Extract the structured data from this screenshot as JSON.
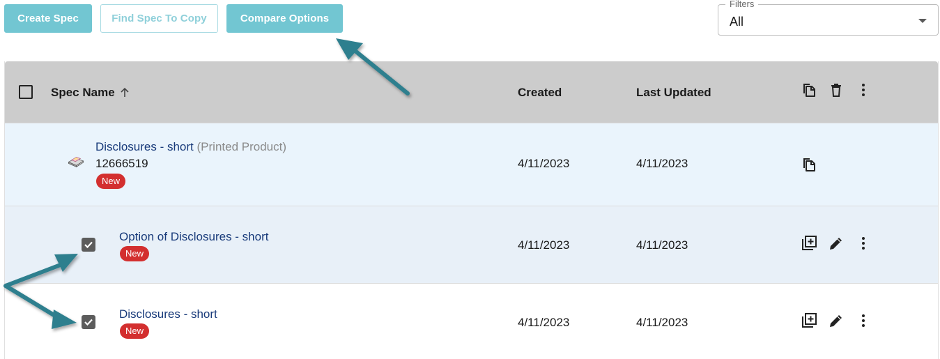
{
  "toolbar": {
    "create_label": "Create Spec",
    "find_label": "Find Spec To Copy",
    "compare_label": "Compare Options"
  },
  "filters": {
    "legend": "Filters",
    "selected": "All"
  },
  "table": {
    "headers": {
      "name": "Spec Name",
      "created": "Created",
      "updated": "Last Updated"
    },
    "rows": [
      {
        "name": "Disclosures - short",
        "type": "(Printed Product)",
        "id": "12666519",
        "badge": "New",
        "created": "4/11/2023",
        "updated": "4/11/2023"
      },
      {
        "name": "Option of Disclosures - short",
        "badge": "New",
        "created": "4/11/2023",
        "updated": "4/11/2023"
      },
      {
        "name": "Disclosures - short",
        "badge": "New",
        "created": "4/11/2023",
        "updated": "4/11/2023"
      }
    ]
  },
  "colors": {
    "accent": "#72c6d2",
    "header_bg": "#cccccc",
    "badge": "#d32f2f",
    "link": "#183a7a",
    "annotation_arrow": "#2f7f8e"
  },
  "icons": [
    "copy-icon",
    "trash-icon",
    "more-vert-icon",
    "add-box-icon",
    "pencil-icon",
    "sort-up-arrow-icon",
    "printed-product-icon",
    "checkbox-icon"
  ]
}
